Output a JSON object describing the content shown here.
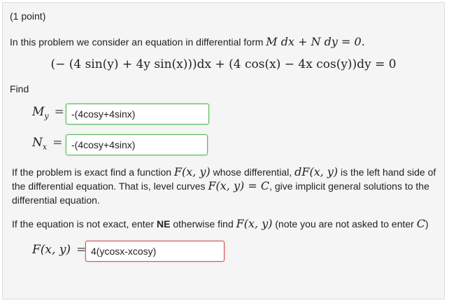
{
  "points": "(1 point)",
  "intro": {
    "text": "In this problem we consider an equation in differential form",
    "math": "M dx + N dy = 0."
  },
  "equation": "(− (4 sin(y) + 4y sin(x)))dx + (4 cos(x) − 4x cos(y))dy = 0",
  "find_label": "Find",
  "my": {
    "label": "M",
    "sub": "y",
    "eq": "=",
    "value": "-(4cosy+4sinx)"
  },
  "nx": {
    "label": "N",
    "sub": "x",
    "eq": "=",
    "value": "-(4cosy+4sinx)"
  },
  "exact_para": {
    "t1": "If the problem is exact find a function ",
    "m1": "F(x, y)",
    "t2": " whose differential, ",
    "m2": "dF(x, y)",
    "t3": " is the left hand side of the differential equation. That is, level curves ",
    "m3": "F(x, y) = C",
    "t4": ", give implicit general solutions to the differential equation."
  },
  "not_exact_para": {
    "t1": "If the equation is not exact, enter ",
    "ne": "NE",
    "t2": " otherwise find ",
    "m1": "F(x, y)",
    "t3": " (note you are not asked to enter ",
    "m2": "C",
    "t4": ")"
  },
  "f": {
    "label": "F(x, y)",
    "eq": "=",
    "value": "4(ycosx-xcosy)"
  },
  "colors": {
    "correct_border": "#5cb85c",
    "incorrect_border": "#d9534f"
  }
}
